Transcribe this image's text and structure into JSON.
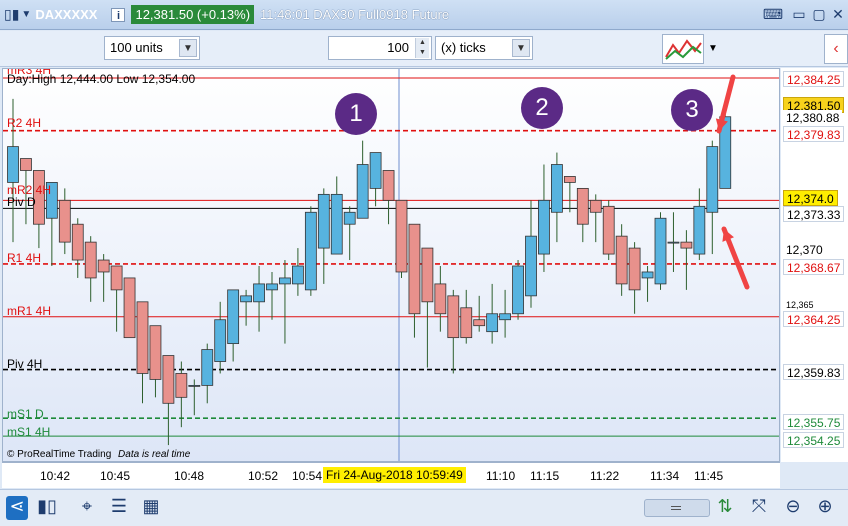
{
  "titlebar": {
    "symbol": "DAXXXXX",
    "price_box": "12,381.50 (+0.13%)",
    "time_instrument": "11:48:01 DAX30 Full0918 Future"
  },
  "toolbar": {
    "units_label": "100 units",
    "ticks_value": "100",
    "ticks_unit_label": "(x) ticks"
  },
  "chart": {
    "day_high_low": "Day:High 12,444.00 Low 12,354.00",
    "watermark": "© ProRealTime Trading",
    "realtime_note": "Data is real time",
    "annotations": [
      "1",
      "2",
      "3"
    ],
    "levels": [
      {
        "name": "mR3 4H",
        "price": 12384.25,
        "price_label": "12,384.25",
        "color": "#e01010",
        "style": "solid"
      },
      {
        "name": "R2 4H",
        "price": 12379.83,
        "price_label": "12,379.83",
        "color": "#e01010",
        "style": "dashed"
      },
      {
        "name": "mR2 4H",
        "price": 12374.0,
        "price_label": "",
        "color": "#e01010",
        "style": "solid"
      },
      {
        "name": "Piv D",
        "price": 12373.33,
        "price_label": "12,373.33",
        "color": "#000000",
        "style": "solid"
      },
      {
        "name": "R1 4H",
        "price": 12368.67,
        "price_label": "12,368.67",
        "color": "#e01010",
        "style": "dashed"
      },
      {
        "name": "mR1 4H",
        "price": 12364.25,
        "price_label": "12,364.25",
        "color": "#e01010",
        "style": "solid"
      },
      {
        "name": "Piv 4H",
        "price": 12359.83,
        "price_label": "12,359.83",
        "color": "#000000",
        "style": "dashed"
      },
      {
        "name": "mS1 D",
        "price": 12355.75,
        "price_label": "12,355.75",
        "color": "#1e8a3a",
        "style": "dashed"
      },
      {
        "name": "mS1 4H",
        "price": 12354.25,
        "price_label": "12,354.25",
        "color": "#1e8a3a",
        "style": "solid"
      }
    ]
  },
  "price_axis": {
    "current_price": "12,381.50",
    "tick_12380": "12,380.88",
    "highlight_374": "12,374.0",
    "tick_12370": "12,370",
    "tick_12365": "12,365"
  },
  "time_axis": {
    "labels": [
      "10:42",
      "10:45",
      "10:48",
      "10:52",
      "10:54",
      "11:10",
      "11:15",
      "11:22",
      "11:34",
      "11:45"
    ],
    "cursor_label": "Fri 24-Aug-2018 10:59:49"
  },
  "chart_data": {
    "type": "candlestick",
    "candles": [
      {
        "o": 12375.5,
        "h": 12382.5,
        "l": 12370.5,
        "c": 12378.5
      },
      {
        "o": 12377.5,
        "h": 12377.5,
        "l": 12372.0,
        "c": 12376.5
      },
      {
        "o": 12376.5,
        "h": 12376.5,
        "l": 12370.0,
        "c": 12372.0
      },
      {
        "o": 12372.5,
        "h": 12375.0,
        "l": 12368.5,
        "c": 12375.5
      },
      {
        "o": 12374.0,
        "h": 12375.0,
        "l": 12369.5,
        "c": 12370.5
      },
      {
        "o": 12372.0,
        "h": 12372.5,
        "l": 12367.5,
        "c": 12369.0
      },
      {
        "o": 12370.5,
        "h": 12371.0,
        "l": 12365.5,
        "c": 12367.5
      },
      {
        "o": 12369.0,
        "h": 12369.5,
        "l": 12365.5,
        "c": 12368.0
      },
      {
        "o": 12368.5,
        "h": 12368.5,
        "l": 12363.0,
        "c": 12366.5
      },
      {
        "o": 12367.5,
        "h": 12367.5,
        "l": 12362.5,
        "c": 12362.5
      },
      {
        "o": 12365.5,
        "h": 12365.5,
        "l": 12357.0,
        "c": 12359.5
      },
      {
        "o": 12363.5,
        "h": 12363.5,
        "l": 12357.5,
        "c": 12359.0
      },
      {
        "o": 12361.0,
        "h": 12361.0,
        "l": 12353.5,
        "c": 12357.0
      },
      {
        "o": 12359.5,
        "h": 12360.5,
        "l": 12355.0,
        "c": 12357.5
      },
      {
        "o": 12358.5,
        "h": 12359.0,
        "l": 12356.0,
        "c": 12358.5
      },
      {
        "o": 12358.5,
        "h": 12362.0,
        "l": 12357.0,
        "c": 12361.5
      },
      {
        "o": 12360.5,
        "h": 12365.5,
        "l": 12359.5,
        "c": 12364.0
      },
      {
        "o": 12362.0,
        "h": 12366.5,
        "l": 12360.5,
        "c": 12366.5
      },
      {
        "o": 12365.5,
        "h": 12366.5,
        "l": 12363.5,
        "c": 12366.0
      },
      {
        "o": 12365.5,
        "h": 12368.5,
        "l": 12363.0,
        "c": 12367.0
      },
      {
        "o": 12366.5,
        "h": 12368.0,
        "l": 12364.0,
        "c": 12367.0
      },
      {
        "o": 12367.0,
        "h": 12369.0,
        "l": 12362.0,
        "c": 12367.5
      },
      {
        "o": 12367.0,
        "h": 12370.0,
        "l": 12366.0,
        "c": 12368.5
      },
      {
        "o": 12366.5,
        "h": 12373.5,
        "l": 12366.0,
        "c": 12373.0
      },
      {
        "o": 12370.0,
        "h": 12375.0,
        "l": 12367.0,
        "c": 12374.5
      },
      {
        "o": 12369.5,
        "h": 12376.0,
        "l": 12369.5,
        "c": 12374.5
      },
      {
        "o": 12372.0,
        "h": 12373.5,
        "l": 12369.0,
        "c": 12373.0
      },
      {
        "o": 12372.5,
        "h": 12379.0,
        "l": 12372.5,
        "c": 12377.0
      },
      {
        "o": 12375.0,
        "h": 12378.0,
        "l": 12373.5,
        "c": 12378.0
      },
      {
        "o": 12376.5,
        "h": 12376.5,
        "l": 12372.0,
        "c": 12374.0
      },
      {
        "o": 12374.0,
        "h": 12374.0,
        "l": 12367.5,
        "c": 12368.0
      },
      {
        "o": 12372.0,
        "h": 12372.0,
        "l": 12362.5,
        "c": 12364.5
      },
      {
        "o": 12370.0,
        "h": 12370.0,
        "l": 12360.0,
        "c": 12365.5
      },
      {
        "o": 12367.0,
        "h": 12368.5,
        "l": 12363.0,
        "c": 12364.5
      },
      {
        "o": 12366.0,
        "h": 12366.5,
        "l": 12359.5,
        "c": 12362.5
      },
      {
        "o": 12365.0,
        "h": 12366.5,
        "l": 12362.0,
        "c": 12362.5
      },
      {
        "o": 12364.0,
        "h": 12366.0,
        "l": 12363.0,
        "c": 12363.5
      },
      {
        "o": 12363.0,
        "h": 12367.0,
        "l": 12362.0,
        "c": 12364.5
      },
      {
        "o": 12364.0,
        "h": 12366.5,
        "l": 12362.5,
        "c": 12364.5
      },
      {
        "o": 12364.5,
        "h": 12369.0,
        "l": 12364.0,
        "c": 12368.5
      },
      {
        "o": 12366.0,
        "h": 12374.0,
        "l": 12365.0,
        "c": 12371.0
      },
      {
        "o": 12369.5,
        "h": 12377.0,
        "l": 12368.0,
        "c": 12374.0
      },
      {
        "o": 12373.0,
        "h": 12378.0,
        "l": 12370.5,
        "c": 12377.0
      },
      {
        "o": 12376.0,
        "h": 12376.0,
        "l": 12373.0,
        "c": 12375.5
      },
      {
        "o": 12375.0,
        "h": 12375.0,
        "l": 12370.5,
        "c": 12372.0
      },
      {
        "o": 12374.0,
        "h": 12374.5,
        "l": 12370.5,
        "c": 12373.0
      },
      {
        "o": 12373.5,
        "h": 12374.0,
        "l": 12369.0,
        "c": 12369.5
      },
      {
        "o": 12371.0,
        "h": 12372.0,
        "l": 12366.0,
        "c": 12367.0
      },
      {
        "o": 12370.0,
        "h": 12370.5,
        "l": 12364.5,
        "c": 12366.5
      },
      {
        "o": 12367.5,
        "h": 12368.5,
        "l": 12365.5,
        "c": 12368.0
      },
      {
        "o": 12367.0,
        "h": 12373.0,
        "l": 12366.5,
        "c": 12372.5
      },
      {
        "o": 12370.5,
        "h": 12373.0,
        "l": 12368.0,
        "c": 12370.5
      },
      {
        "o": 12370.5,
        "h": 12371.5,
        "l": 12366.5,
        "c": 12370.0
      },
      {
        "o": 12369.5,
        "h": 12375.0,
        "l": 12369.0,
        "c": 12373.5
      },
      {
        "o": 12373.0,
        "h": 12379.0,
        "l": 12369.5,
        "c": 12378.5
      },
      {
        "o": 12375.0,
        "h": 12382.0,
        "l": 12375.0,
        "c": 12381.0
      }
    ],
    "ylim": [
      12352.0,
      12385.0
    ],
    "up_color": "#57b3df",
    "down_color": "#e8918c"
  }
}
